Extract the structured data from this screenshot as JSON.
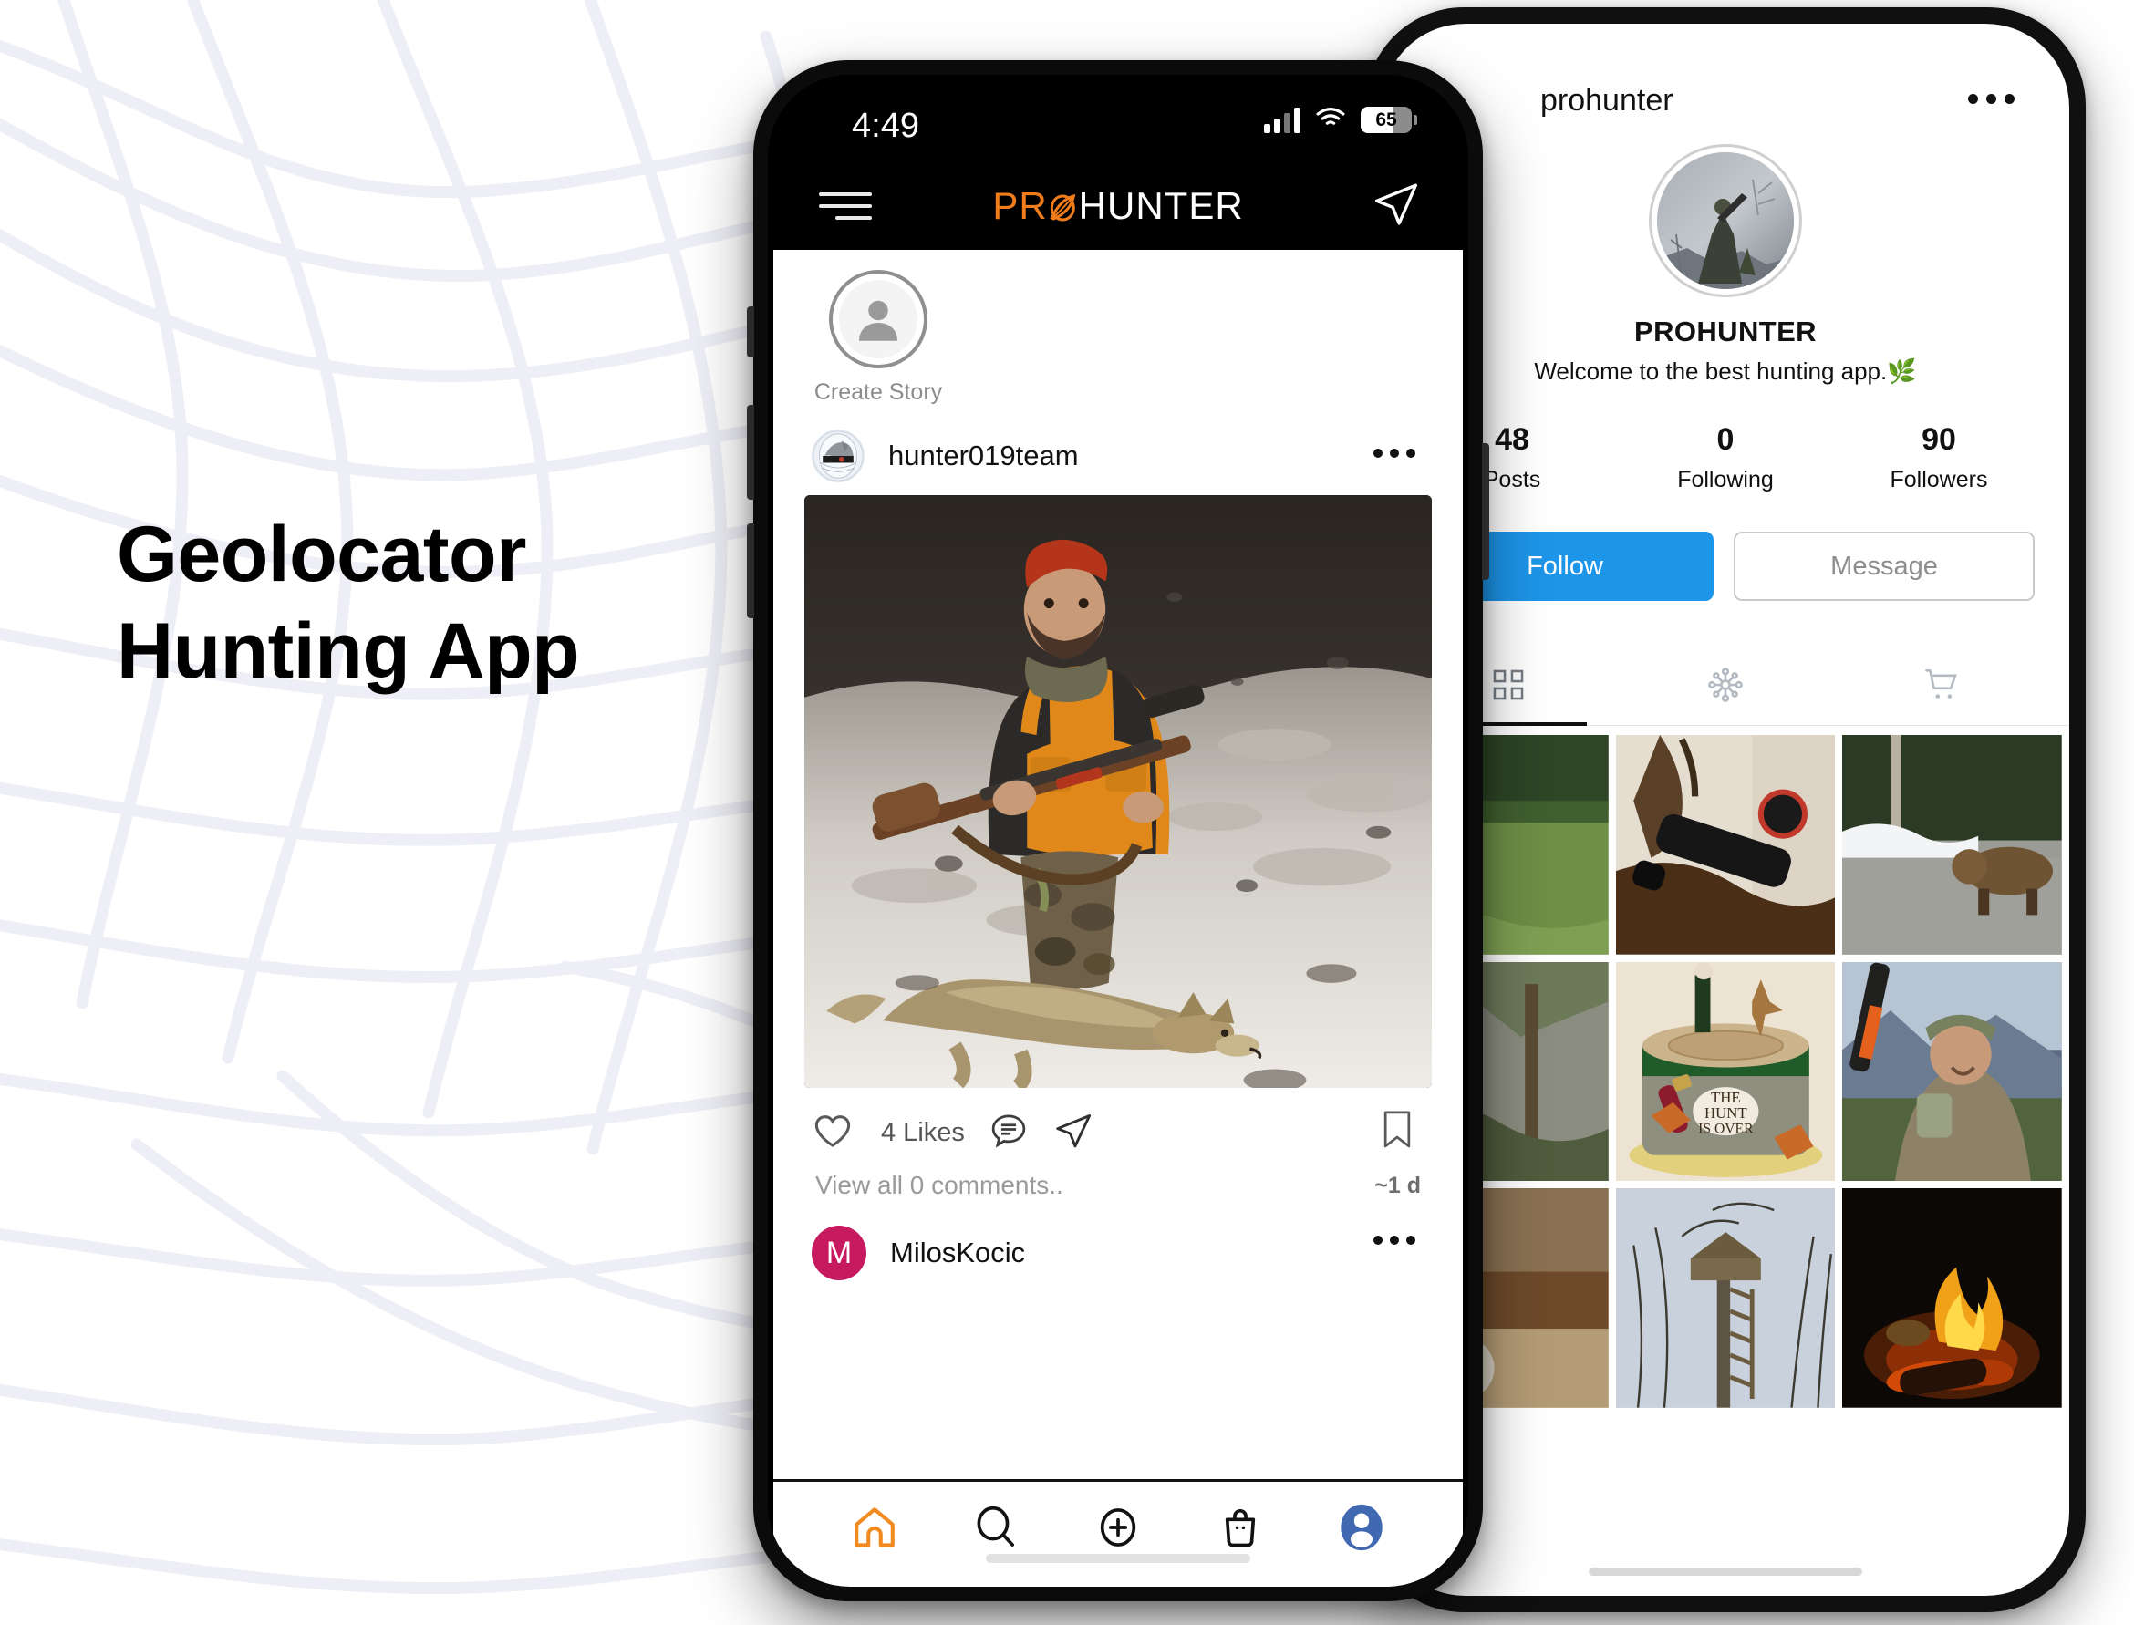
{
  "hero": {
    "line1": "Geolocator",
    "line2": "Hunting App"
  },
  "phone_left": {
    "status_bar": {
      "time": "4:49",
      "battery_percent": "65",
      "signal_icon": "cellular-signal-icon",
      "wifi_icon": "wifi-icon",
      "battery_icon": "battery-icon"
    },
    "app_bar": {
      "menu_icon": "hamburger-menu-icon",
      "brand_pro": "PR",
      "brand_oslash": "Ø",
      "brand_hunter": "HUNTER",
      "send_icon": "paper-plane-icon"
    },
    "story": {
      "label": "Create Story",
      "avatar_icon": "person-avatar-icon"
    },
    "post": {
      "author": "hunter019team",
      "author_avatar_icon": "hunter019team-logo-icon",
      "more_icon": "more-options-icon",
      "photo_alt": "hunter-with-rifle-and-jackal-in-snow",
      "like_icon": "heart-outline-icon",
      "likes": "4 Likes",
      "comment_icon": "comment-bubble-icon",
      "share_icon": "share-paper-plane-icon",
      "bookmark_icon": "bookmark-outline-icon",
      "comments_link": "View all 0 comments..",
      "time_ago": "~1 d"
    },
    "comment": {
      "avatar_letter": "M",
      "name": "MilosKocic",
      "more_icon": "more-options-icon"
    },
    "tabbar": {
      "items": [
        {
          "name": "home",
          "icon": "home-icon",
          "active": true
        },
        {
          "name": "search",
          "icon": "search-icon",
          "active": false
        },
        {
          "name": "add",
          "icon": "plus-circle-icon",
          "active": false
        },
        {
          "name": "shop",
          "icon": "shopping-bag-icon",
          "active": false
        },
        {
          "name": "profile",
          "icon": "profile-avatar-icon",
          "active": false
        }
      ]
    },
    "accent_color": "#f07d1a",
    "profile_color": "#4169b2"
  },
  "phone_right": {
    "header": {
      "username": "prohunter",
      "more_icon": "more-options-icon"
    },
    "avatar_icon": "prohunter-profile-photo",
    "full_name": "PROHUNTER",
    "bio": "Welcome to the best hunting app.",
    "bio_emoji": "🌿",
    "stats": [
      {
        "num": "48",
        "label": "Posts"
      },
      {
        "num": "0",
        "label": "Following"
      },
      {
        "num": "90",
        "label": "Followers"
      }
    ],
    "buttons": {
      "follow": "Follow",
      "message": "Message"
    },
    "tabs": [
      {
        "name": "grid",
        "icon": "grid-icon",
        "active": true
      },
      {
        "name": "tagged",
        "icon": "network-nodes-icon",
        "active": false
      },
      {
        "name": "shop",
        "icon": "shopping-cart-icon",
        "active": false
      }
    ],
    "grid_items": [
      {
        "alt": "deer-in-green-field"
      },
      {
        "alt": "thermal-scope-on-bear-paw"
      },
      {
        "alt": "brown-bear-on-snowy-road"
      },
      {
        "alt": "rocky-forest-cliff"
      },
      {
        "alt": "hunting-themed-cake-the-hunt-is-over"
      },
      {
        "alt": "hunter-selfie-in-mountains"
      },
      {
        "alt": "wooden-cabin-in-woods"
      },
      {
        "alt": "elevated-deer-stand-in-tree"
      },
      {
        "alt": "campfire-at-night"
      }
    ],
    "follow_color": "#1d95e8"
  }
}
